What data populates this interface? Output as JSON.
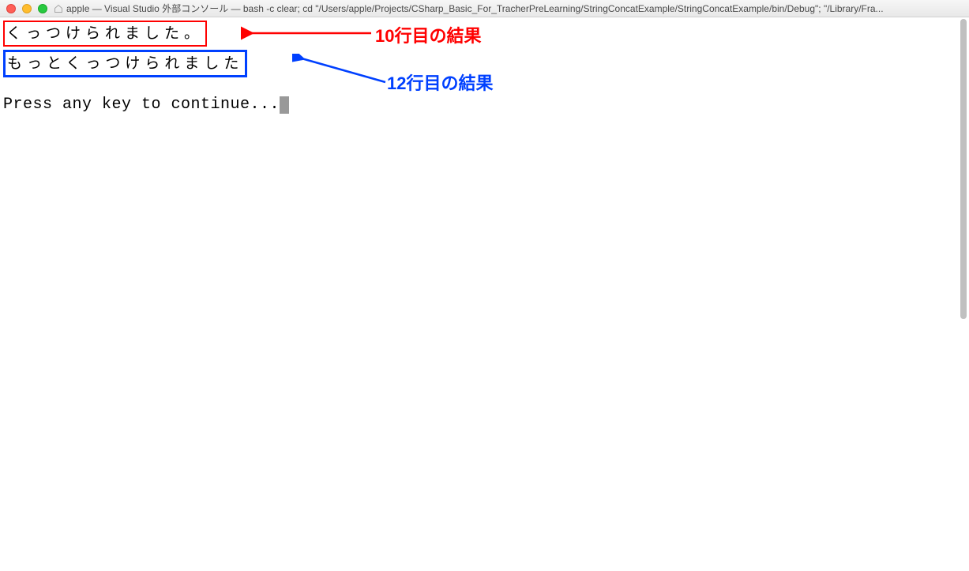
{
  "titlebar": {
    "title": "apple — Visual Studio 外部コンソール — bash -c clear; cd \"/Users/apple/Projects/CSharp_Basic_For_TracherPreLearning/StringConcatExample/StringConcatExample/bin/Debug\"; \"/Library/Fra..."
  },
  "console": {
    "line1": "くっつけられました。",
    "line2": "もっとくっつけられました",
    "prompt": "Press any key to continue..."
  },
  "annotations": {
    "red": "10行目の結果",
    "blue": "12行目の結果"
  },
  "colors": {
    "red_box": "#ff0000",
    "blue_box": "#0040ff"
  }
}
